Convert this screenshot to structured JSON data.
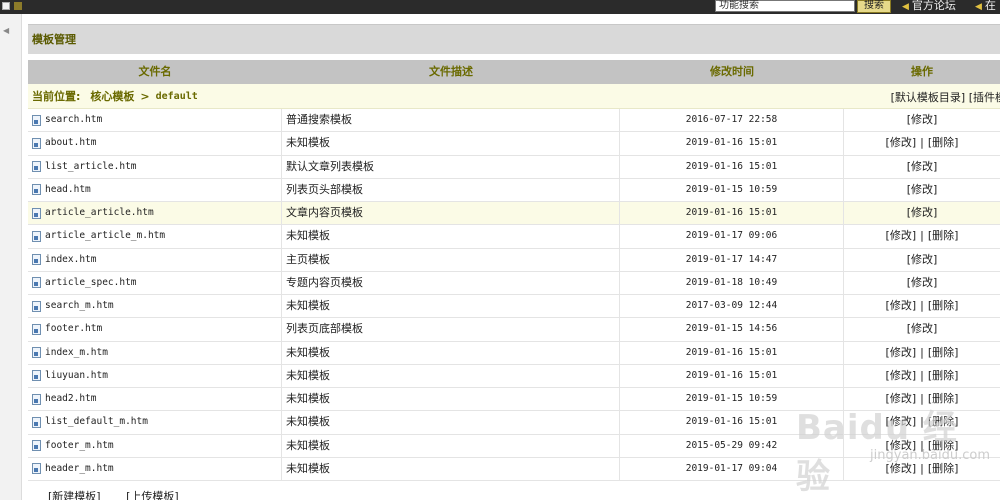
{
  "topbar": {
    "search_value": "功能搜索",
    "search_button": "搜索",
    "forum_link": "官方论坛",
    "cut_link": "在"
  },
  "panel": {
    "title": "模板管理"
  },
  "table": {
    "headers": [
      "文件名",
      "文件描述",
      "修改时间",
      "操作"
    ],
    "breadcrumb": {
      "label": "当前位置:",
      "root": "核心模板",
      "separator": ">",
      "current": "default",
      "right_links": "[默认模板目录] [插件模"
    },
    "rows": [
      {
        "file": "search.htm",
        "desc": "普通搜索模板",
        "time": "2016-07-17 22:58",
        "ops": [
          "[修改]"
        ]
      },
      {
        "file": "about.htm",
        "desc": "未知模板",
        "time": "2019-01-16 15:01",
        "ops": [
          "[修改]",
          "|",
          "[删除]"
        ]
      },
      {
        "file": "list_article.htm",
        "desc": "默认文章列表模板",
        "time": "2019-01-16 15:01",
        "ops": [
          "[修改]"
        ]
      },
      {
        "file": "head.htm",
        "desc": "列表页头部模板",
        "time": "2019-01-15 10:59",
        "ops": [
          "[修改]"
        ]
      },
      {
        "file": "article_article.htm",
        "desc": "文章内容页模板",
        "time": "2019-01-16 15:01",
        "ops": [
          "[修改]"
        ]
      },
      {
        "file": "article_article_m.htm",
        "desc": "未知模板",
        "time": "2019-01-17 09:06",
        "ops": [
          "[修改]",
          "|",
          "[删除]"
        ]
      },
      {
        "file": "index.htm",
        "desc": "主页模板",
        "time": "2019-01-17 14:47",
        "ops": [
          "[修改]"
        ]
      },
      {
        "file": "article_spec.htm",
        "desc": "专题内容页模板",
        "time": "2019-01-18 10:49",
        "ops": [
          "[修改]"
        ]
      },
      {
        "file": "search_m.htm",
        "desc": "未知模板",
        "time": "2017-03-09 12:44",
        "ops": [
          "[修改]",
          "|",
          "[删除]"
        ]
      },
      {
        "file": "footer.htm",
        "desc": "列表页底部模板",
        "time": "2019-01-15 14:56",
        "ops": [
          "[修改]"
        ]
      },
      {
        "file": "index_m.htm",
        "desc": "未知模板",
        "time": "2019-01-16 15:01",
        "ops": [
          "[修改]",
          "|",
          "[删除]"
        ]
      },
      {
        "file": "liuyuan.htm",
        "desc": "未知模板",
        "time": "2019-01-16 15:01",
        "ops": [
          "[修改]",
          "|",
          "[删除]"
        ]
      },
      {
        "file": "head2.htm",
        "desc": "未知模板",
        "time": "2019-01-15 10:59",
        "ops": [
          "[修改]",
          "|",
          "[删除]"
        ]
      },
      {
        "file": "list_default_m.htm",
        "desc": "未知模板",
        "time": "2019-01-16 15:01",
        "ops": [
          "[修改]",
          "|",
          "[删除]"
        ]
      },
      {
        "file": "footer_m.htm",
        "desc": "未知模板",
        "time": "2015-05-29 09:42",
        "ops": [
          "[修改]",
          "|",
          "[删除]"
        ]
      },
      {
        "file": "header_m.htm",
        "desc": "未知模板",
        "time": "2019-01-17 09:04",
        "ops": [
          "[修改]",
          "|",
          "[删除]"
        ]
      }
    ]
  },
  "footer": {
    "new_template": "[新建模板]",
    "upload_template": "[上传模板]"
  },
  "watermark": {
    "brand": "Baidu 经验",
    "url": "jingyan.baidu.com"
  }
}
